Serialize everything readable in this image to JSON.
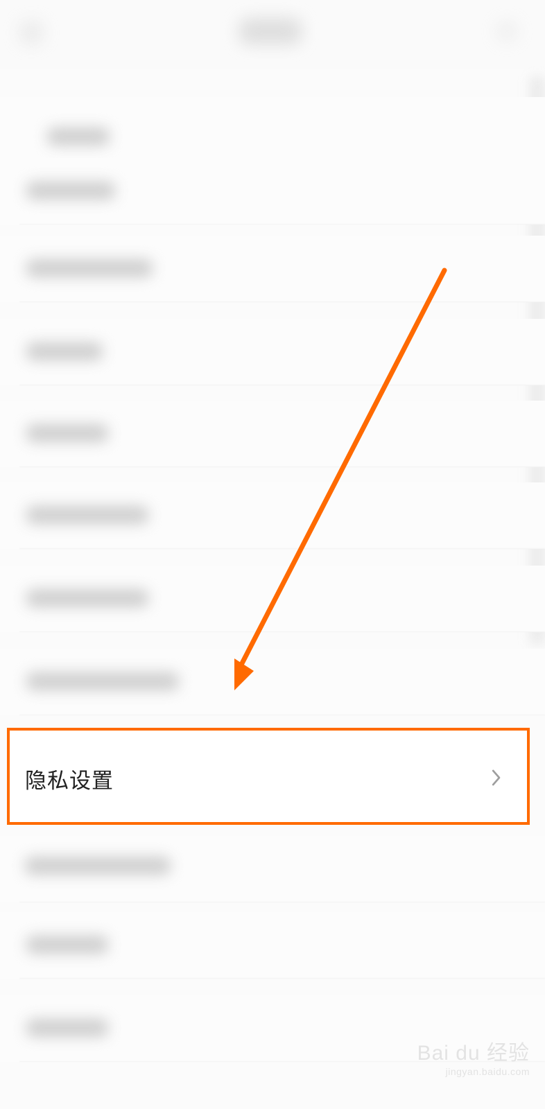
{
  "highlighted_item": {
    "label": "隐私设置"
  },
  "icons": {
    "chevron": "chevron-right-icon",
    "arrow": "annotation-arrow-icon"
  },
  "colors": {
    "annotation": "#ff6a00"
  },
  "watermark": {
    "main": "Bai du 经验",
    "sub": "jingyan.baidu.com"
  }
}
